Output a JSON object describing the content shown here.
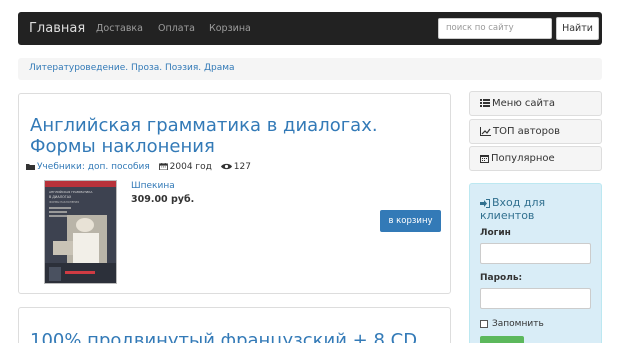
{
  "navbar": {
    "brand": "Главная",
    "links": [
      "Доставка",
      "Оплата",
      "Корзина"
    ],
    "search_placeholder": "поиск по сайту",
    "search_button": "Найти"
  },
  "breadcrumb": "Литературоведение. Проза. Поэзия. Драма",
  "books": [
    {
      "title": "Английская грамматика в диалогах. Формы наклонения",
      "category": "Учебники: доп. пособия",
      "year": "2004 год",
      "views": "127",
      "author": "Шпекина",
      "price": "309.00 руб.",
      "cart_button": "в корзину",
      "cover_text": [
        "АНГЛИЙСКАЯ ГРАММАТИКА",
        "В ДИАЛОГАХ",
        "ФОРМЫ НАКЛОНЕНИЯ"
      ]
    },
    {
      "title": "100% продвинутый французский + 8 CD"
    }
  ],
  "sidebar": {
    "items": [
      "Меню сайта",
      "ТОП авторов",
      "Популярное"
    ],
    "icons": [
      "list-icon",
      "chart-icon",
      "calendar-icon"
    ]
  },
  "login": {
    "title": "Вход для клиентов",
    "login_label": "Логин",
    "password_label": "Пароль:",
    "remember_label": "Запомнить"
  },
  "colors": {
    "navbar_bg": "#222222",
    "link": "#337ab7",
    "button_primary": "#337ab7",
    "login_panel_bg": "#d9edf7",
    "login_title": "#31708f",
    "enter_button": "#5cb85c"
  }
}
